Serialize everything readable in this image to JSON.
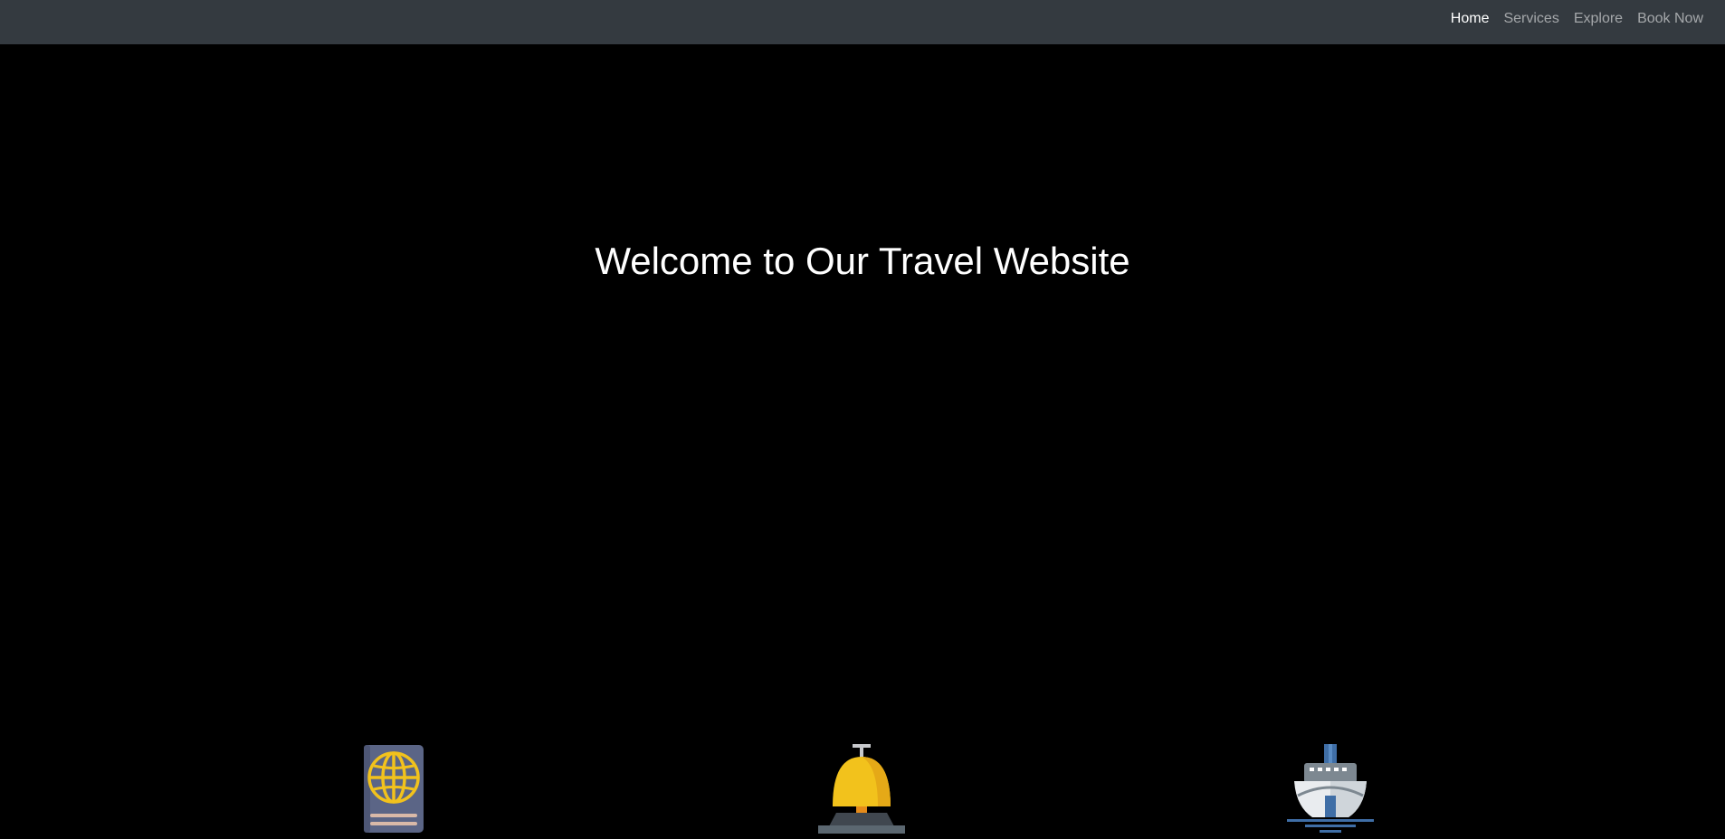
{
  "navbar": {
    "links": [
      {
        "label": "Home",
        "active": true
      },
      {
        "label": "Services",
        "active": false
      },
      {
        "label": "Explore",
        "active": false
      },
      {
        "label": "Book Now",
        "active": false
      }
    ],
    "background_color": "#343a40"
  },
  "hero": {
    "title": "Welcome to Our Travel Website",
    "background_color": "#000000"
  },
  "features": [
    {
      "icon": "passport-icon"
    },
    {
      "icon": "service-bell-icon"
    },
    {
      "icon": "cruise-ship-icon"
    }
  ]
}
